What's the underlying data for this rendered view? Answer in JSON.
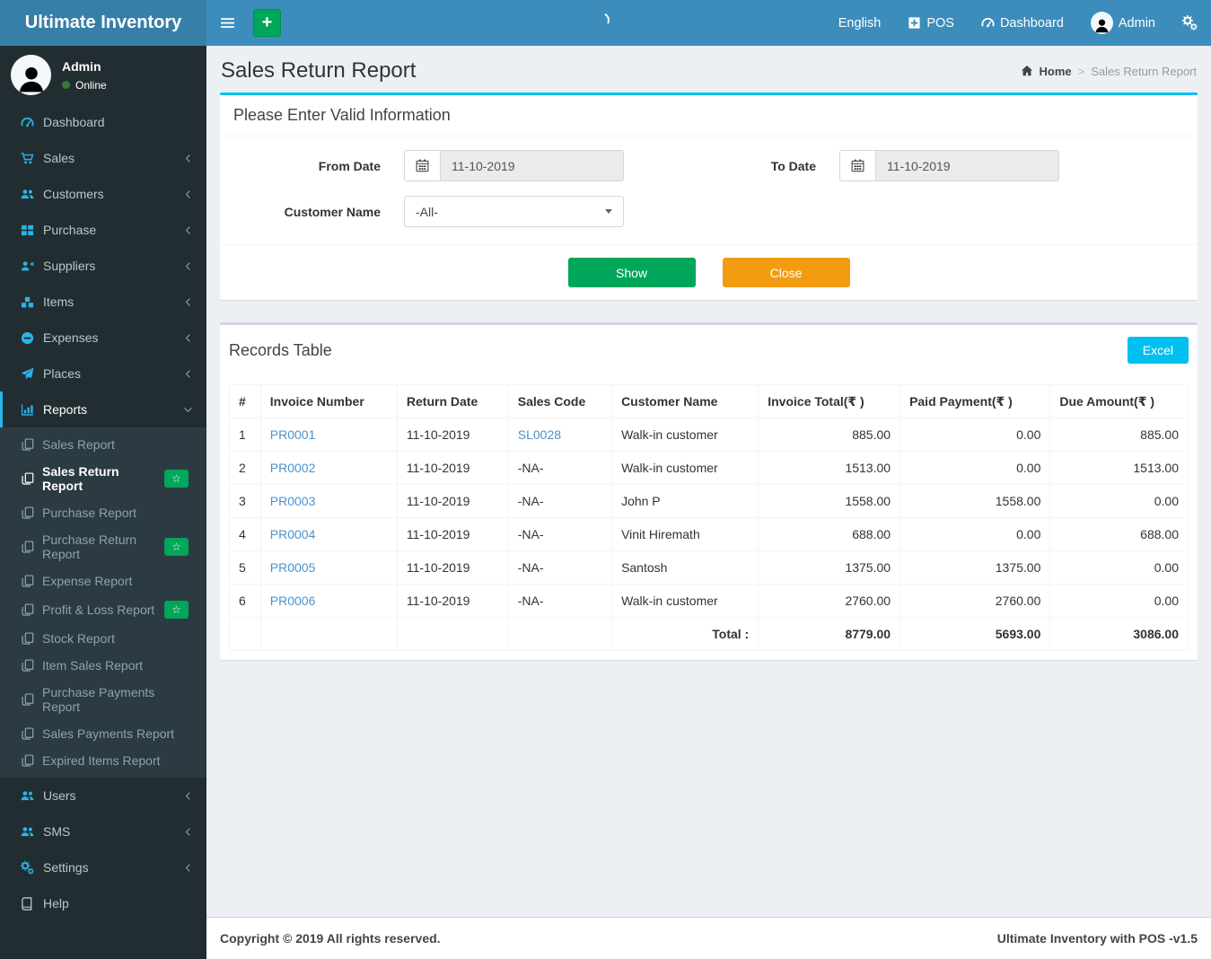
{
  "brand": "Ultimate Inventory",
  "navbar": {
    "language": "English",
    "pos": "POS",
    "dashboard": "Dashboard",
    "user": "Admin",
    "quick_add": "+"
  },
  "icons": {
    "star": "☆"
  },
  "colors": {
    "navbar": "#3c8dbc",
    "logo_bg": "#367fa9",
    "sidebar_bg": "#222d32",
    "sidebar_icon": "#29b5e8",
    "info_accent": "#00c0ef",
    "success_green": "#00a65a",
    "warning_orange": "#f39c12",
    "online_dot": "#3c763d"
  },
  "sidebar": {
    "user_name": "Admin",
    "user_status": "Online",
    "menu": {
      "dashboard": "Dashboard",
      "sales": "Sales",
      "customers": "Customers",
      "purchase": "Purchase",
      "suppliers": "Suppliers",
      "items": "Items",
      "expenses": "Expenses",
      "places": "Places",
      "reports": "Reports",
      "users": "Users",
      "sms": "SMS",
      "settings": "Settings",
      "help": "Help"
    },
    "report_items": [
      {
        "label": "Sales Report"
      },
      {
        "label": "Sales Return Report"
      },
      {
        "label": "Purchase Report"
      },
      {
        "label": "Purchase Return Report"
      },
      {
        "label": "Expense Report"
      },
      {
        "label": "Profit & Loss Report"
      },
      {
        "label": "Stock Report"
      },
      {
        "label": "Item Sales Report"
      },
      {
        "label": "Purchase Payments Report"
      },
      {
        "label": "Sales Payments Report"
      },
      {
        "label": "Expired Items Report"
      }
    ]
  },
  "page": {
    "title": "Sales Return Report",
    "breadcrumb_home": "Home",
    "breadcrumb_sep": ">",
    "breadcrumb_current": "Sales Return Report"
  },
  "filter": {
    "panel_title": "Please Enter Valid Information",
    "from_date_label": "From Date",
    "from_date_value": "11-10-2019",
    "to_date_label": "To Date",
    "to_date_value": "11-10-2019",
    "customer_label": "Customer Name",
    "customer_value": "-All-",
    "show_label": "Show",
    "close_label": "Close"
  },
  "records": {
    "panel_title": "Records Table",
    "excel_label": "Excel",
    "columns": {
      "hash": "#",
      "invoice": "Invoice Number",
      "return_date": "Return Date",
      "sales_code": "Sales Code",
      "customer": "Customer Name",
      "invoice_total": "Invoice Total(₹ )",
      "paid_payment": "Paid Payment(₹ )",
      "due_amount": "Due Amount(₹ )"
    },
    "rows": [
      {
        "num": "1",
        "invoice": "PR0001",
        "date": "11-10-2019",
        "code": "SL0028",
        "customer": "Walk-in customer",
        "total": "885.00",
        "paid": "0.00",
        "due": "885.00"
      },
      {
        "num": "2",
        "invoice": "PR0002",
        "date": "11-10-2019",
        "code": "-NA-",
        "customer": "Walk-in customer",
        "total": "1513.00",
        "paid": "0.00",
        "due": "1513.00"
      },
      {
        "num": "3",
        "invoice": "PR0003",
        "date": "11-10-2019",
        "code": "-NA-",
        "customer": "John P",
        "total": "1558.00",
        "paid": "1558.00",
        "due": "0.00"
      },
      {
        "num": "4",
        "invoice": "PR0004",
        "date": "11-10-2019",
        "code": "-NA-",
        "customer": "Vinit Hiremath",
        "total": "688.00",
        "paid": "0.00",
        "due": "688.00"
      },
      {
        "num": "5",
        "invoice": "PR0005",
        "date": "11-10-2019",
        "code": "-NA-",
        "customer": "Santosh",
        "total": "1375.00",
        "paid": "1375.00",
        "due": "0.00"
      },
      {
        "num": "6",
        "invoice": "PR0006",
        "date": "11-10-2019",
        "code": "-NA-",
        "customer": "Walk-in customer",
        "total": "2760.00",
        "paid": "2760.00",
        "due": "0.00"
      }
    ],
    "totals": {
      "label": "Total :",
      "total": "8779.00",
      "paid": "5693.00",
      "due": "3086.00"
    }
  },
  "footer": {
    "copyright": "Copyright © 2019 All rights reserved.",
    "version": "Ultimate Inventory with POS -v1.5"
  }
}
